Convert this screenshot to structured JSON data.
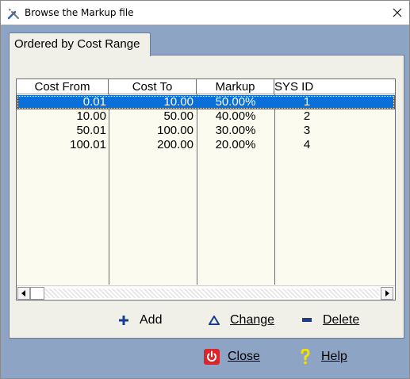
{
  "window": {
    "title": "Browse the Markup file"
  },
  "tabs": [
    {
      "label": "Ordered by Cost Range"
    }
  ],
  "grid": {
    "columns": [
      "Cost From",
      "Cost To",
      "Markup",
      "SYS ID"
    ],
    "rows": [
      {
        "cost_from": "0.01",
        "cost_to": "10.00",
        "markup": "50.00%",
        "sys_id": "1",
        "selected": true
      },
      {
        "cost_from": "10.00",
        "cost_to": "50.00",
        "markup": "40.00%",
        "sys_id": "2",
        "selected": false
      },
      {
        "cost_from": "50.01",
        "cost_to": "100.00",
        "markup": "30.00%",
        "sys_id": "3",
        "selected": false
      },
      {
        "cost_from": "100.01",
        "cost_to": "200.00",
        "markup": "20.00%",
        "sys_id": "4",
        "selected": false
      }
    ]
  },
  "actions": {
    "add_label": "Add",
    "change_label": "Change",
    "delete_label": "Delete",
    "close_label": "Close",
    "help_label": "Help"
  },
  "icons": {
    "title": "tools-icon",
    "add": "plus-icon",
    "change": "triangle-up-icon",
    "delete": "minus-icon",
    "close": "power-icon",
    "help": "question-icon"
  },
  "colors": {
    "frame": "#8ea4c4",
    "panel": "#f1f0e8",
    "grid_bg": "#fbfbef",
    "selection": "#0a6fd8",
    "action_icon": "#1a3d8f",
    "close_icon": "#d8262a",
    "help_icon": "#f2e200"
  }
}
